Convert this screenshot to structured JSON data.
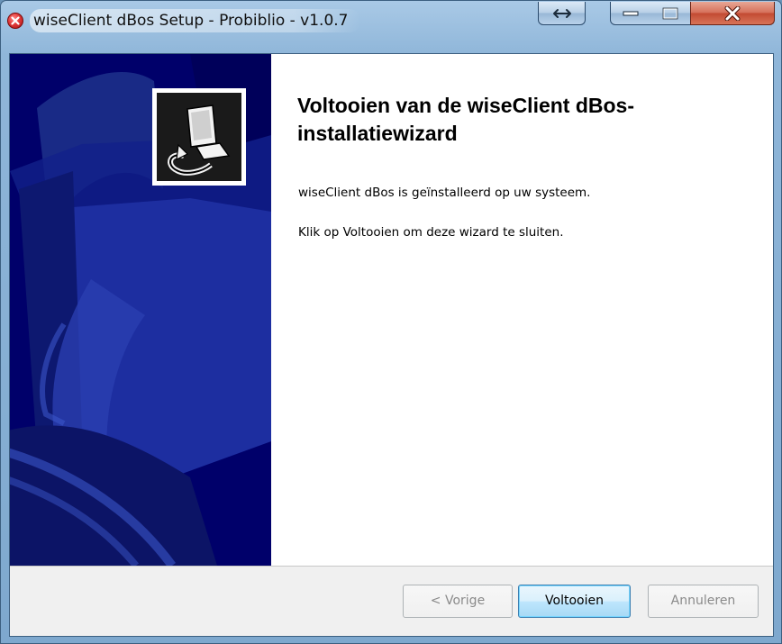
{
  "window": {
    "title": "wiseClient dBos Setup - Probiblio - v1.0.7",
    "caption_buttons": [
      "resize-icon",
      "minimize-icon",
      "maximize-icon",
      "close-icon"
    ]
  },
  "sidebar": {
    "background_color": "#000064",
    "logo_icon": "installer-computer-icon"
  },
  "content": {
    "heading": "Voltooien van de wiseClient dBos-installatiewizard",
    "paragraph_1": "wiseClient dBos is geïnstalleerd op uw systeem.",
    "paragraph_2": "Klik op Voltooien om deze wizard te sluiten."
  },
  "buttons": {
    "back_label": "< Vorige",
    "finish_label": "Voltooien",
    "cancel_label": "Annuleren"
  },
  "colors": {
    "close_button": "#c24a32",
    "accent_button_border": "#3c7fb1",
    "titlebar": "#a9c9e6"
  }
}
